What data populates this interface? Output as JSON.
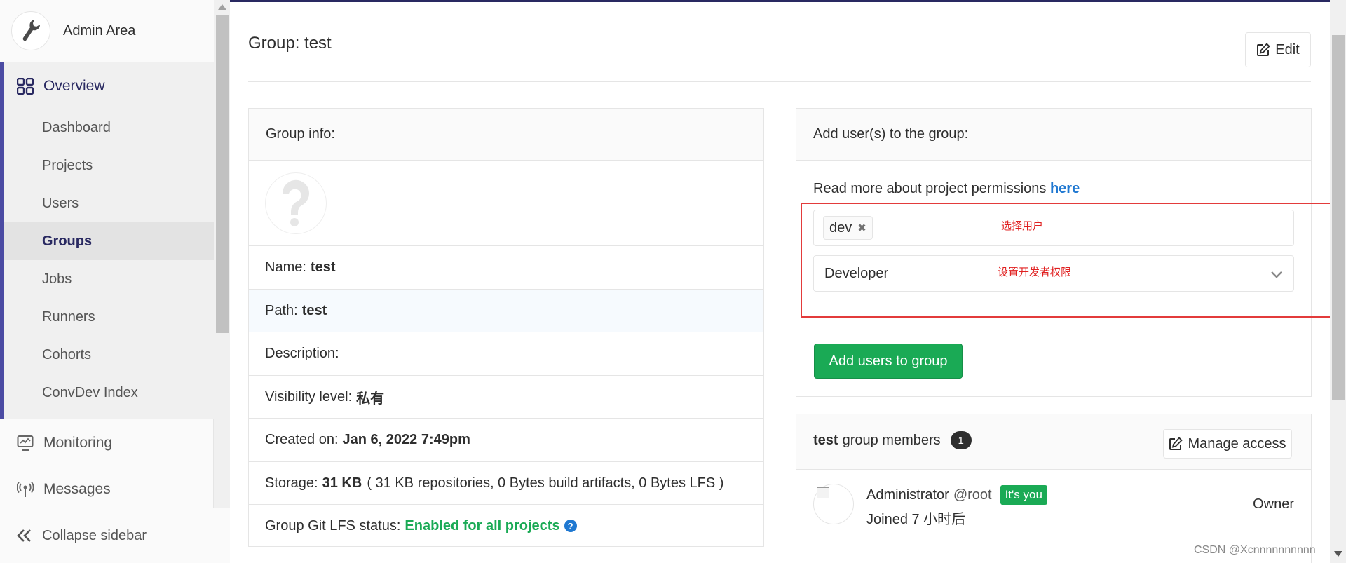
{
  "sidebar": {
    "context_title": "Admin Area",
    "overview_label": "Overview",
    "sub_items": [
      {
        "label": "Dashboard"
      },
      {
        "label": "Projects"
      },
      {
        "label": "Users"
      },
      {
        "label": "Groups",
        "active": true
      },
      {
        "label": "Jobs"
      },
      {
        "label": "Runners"
      },
      {
        "label": "Cohorts"
      },
      {
        "label": "ConvDev Index"
      }
    ],
    "monitoring_label": "Monitoring",
    "messages_label": "Messages",
    "collapse_label": "Collapse sidebar"
  },
  "header": {
    "title": "Group: test",
    "edit_label": "Edit"
  },
  "group_info": {
    "heading": "Group info:",
    "name_label": "Name:",
    "name_value": "test",
    "path_label": "Path:",
    "path_value": "test",
    "description_label": "Description:",
    "visibility_label": "Visibility level:",
    "visibility_value": "私有",
    "created_label": "Created on:",
    "created_value": "Jan 6, 2022 7:49pm",
    "storage_label": "Storage:",
    "storage_value": "31 KB",
    "storage_detail": "( 31 KB repositories, 0 Bytes build artifacts, 0 Bytes LFS )",
    "lfs_label": "Group Git LFS status:",
    "lfs_value": "Enabled for all projects"
  },
  "add_users": {
    "heading": "Add user(s) to the group:",
    "permissions_text": "Read more about project permissions",
    "permissions_link": "here",
    "selected_user": "dev",
    "user_annotation": "选择用户",
    "role_value": "Developer",
    "role_annotation": "设置开发者权限",
    "submit_label": "Add users to group"
  },
  "members": {
    "group_name": "test",
    "title_suffix": "group members",
    "count": "1",
    "manage_label": "Manage access",
    "list": [
      {
        "name": "Administrator",
        "handle": "@root",
        "badge": "It's you",
        "joined": "Joined 7 小时后",
        "role": "Owner"
      }
    ]
  },
  "watermark": "CSDN @Xcnnnnnnnnnn",
  "colors": {
    "brand_dark": "#292961",
    "active_bar": "#4b4ba3",
    "success": "#1aaa55",
    "link": "#1f78d1",
    "annotation_red": "#e33b3b"
  },
  "icons": [
    "wrench-icon",
    "overview-grid-icon",
    "monitoring-icon",
    "messages-icon",
    "collapse-icon",
    "edit-icon",
    "question-icon",
    "remove-token-icon",
    "chevron-down-icon"
  ]
}
